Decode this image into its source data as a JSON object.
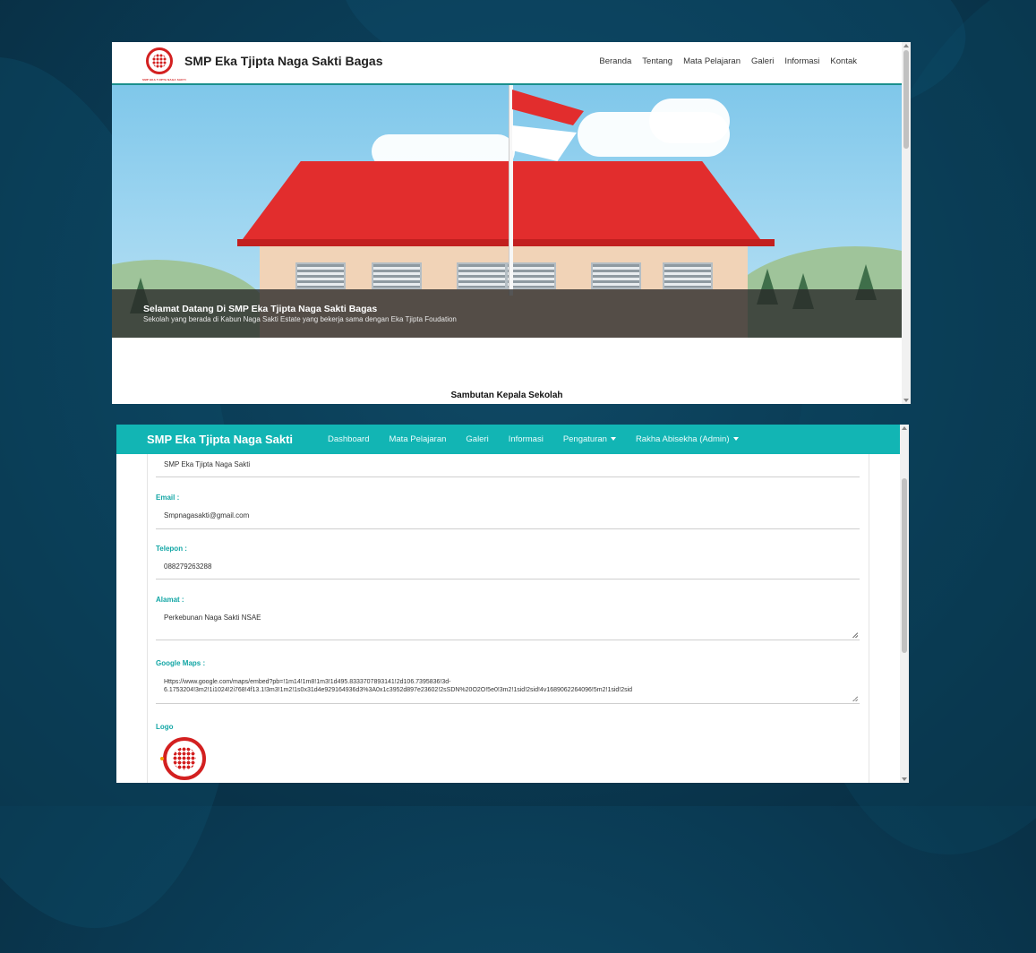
{
  "public_site": {
    "brand": "SMP Eka Tjipta Naga Sakti Bagas",
    "logo_caption": "SMP EKA TJIPTA NAGA SAKTI",
    "nav": [
      "Beranda",
      "Tentang",
      "Mata Pelajaran",
      "Galeri",
      "Informasi",
      "Kontak"
    ],
    "hero": {
      "title": "Selamat Datang Di SMP Eka Tjipta Naga Sakti Bagas",
      "subtitle": "Sekolah yang berada di Kabun Naga Sakti Estate yang bekerja sama dengan Eka Tjipta Foudation"
    },
    "section_heading": "Sambutan Kepala Sekolah"
  },
  "admin": {
    "brand": "SMP Eka Tjipta Naga Sakti",
    "nav": [
      "Dashboard",
      "Mata Pelajaran",
      "Galeri",
      "Informasi"
    ],
    "nav_dropdowns": [
      "Pengaturan",
      "Rakha Abisekha (Admin)"
    ],
    "form": {
      "name_value": "SMP Eka Tjipta Naga Sakti",
      "email_label": "Email :",
      "email_value": "Smpnagasakti@gmail.com",
      "phone_label": "Telepon :",
      "phone_value": "088279263288",
      "address_label": "Alamat :",
      "address_value": "Perkebunan Naga Sakti NSAE",
      "maps_label": "Google Maps :",
      "maps_value_line1": "Https://www.google.com/maps/embed?pb=!1m14!1m8!1m3!1d495.8333707893141!2d106.7395836!3d-",
      "maps_value_line2": "6.1753204!3m2!1i1024!2i768!4f13.1!3m3!1m2!1s0x31d4e929164936d3%3A0x1c3952d897e23602!2sSDN%20O2O!5e0!3m2!1sid!2sid!4v1689062264096!5m2!1sid!2sid",
      "logo_label": "Logo"
    }
  },
  "colors": {
    "teal": "#12b5b4",
    "label_teal": "#13a6a5",
    "roof_red": "#e22d2d",
    "background": "#0a3a53"
  }
}
